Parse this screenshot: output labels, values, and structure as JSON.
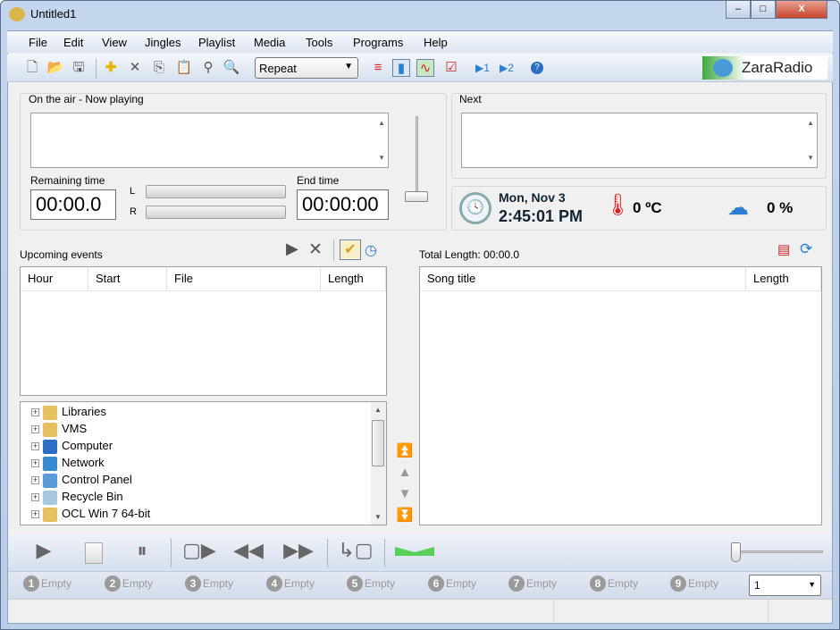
{
  "window": {
    "title": "Untitled1",
    "minimize": "–",
    "maximize": "□",
    "close": "X"
  },
  "menu": [
    "File",
    "Edit",
    "View",
    "Jingles",
    "Playlist",
    "Media",
    "Tools",
    "Programs",
    "Help"
  ],
  "toolbar": {
    "mode_select": "Repeat",
    "brand": "ZaraRadio"
  },
  "now_playing": {
    "label": "On the air - Now playing",
    "remaining_label": "Remaining time",
    "remaining": "00:00.0",
    "end_label": "End time",
    "end": "00:00:00",
    "left": "L",
    "right": "R"
  },
  "next": {
    "label": "Next"
  },
  "info": {
    "date": "Mon, Nov 3",
    "time": "2:45:01 PM",
    "temperature": "0 ºC",
    "humidity": "0 %"
  },
  "events": {
    "label": "Upcoming events",
    "columns": [
      "Hour",
      "Start",
      "File",
      "Length"
    ]
  },
  "tree": [
    "Libraries",
    "VMS",
    "Computer",
    "Network",
    "Control Panel",
    "Recycle Bin",
    "OCL Win 7 64-bit"
  ],
  "playlist": {
    "total_label": "Total Length: 00:00.0",
    "columns": [
      "Song title",
      "Length"
    ]
  },
  "jingles": [
    {
      "n": "1",
      "label": "Empty"
    },
    {
      "n": "2",
      "label": "Empty"
    },
    {
      "n": "3",
      "label": "Empty"
    },
    {
      "n": "4",
      "label": "Empty"
    },
    {
      "n": "5",
      "label": "Empty"
    },
    {
      "n": "6",
      "label": "Empty"
    },
    {
      "n": "7",
      "label": "Empty"
    },
    {
      "n": "8",
      "label": "Empty"
    },
    {
      "n": "9",
      "label": "Empty"
    }
  ],
  "jingle_set": "1",
  "colors": {
    "accent": "#2a7fd4",
    "frame": "#c4d6ee"
  }
}
